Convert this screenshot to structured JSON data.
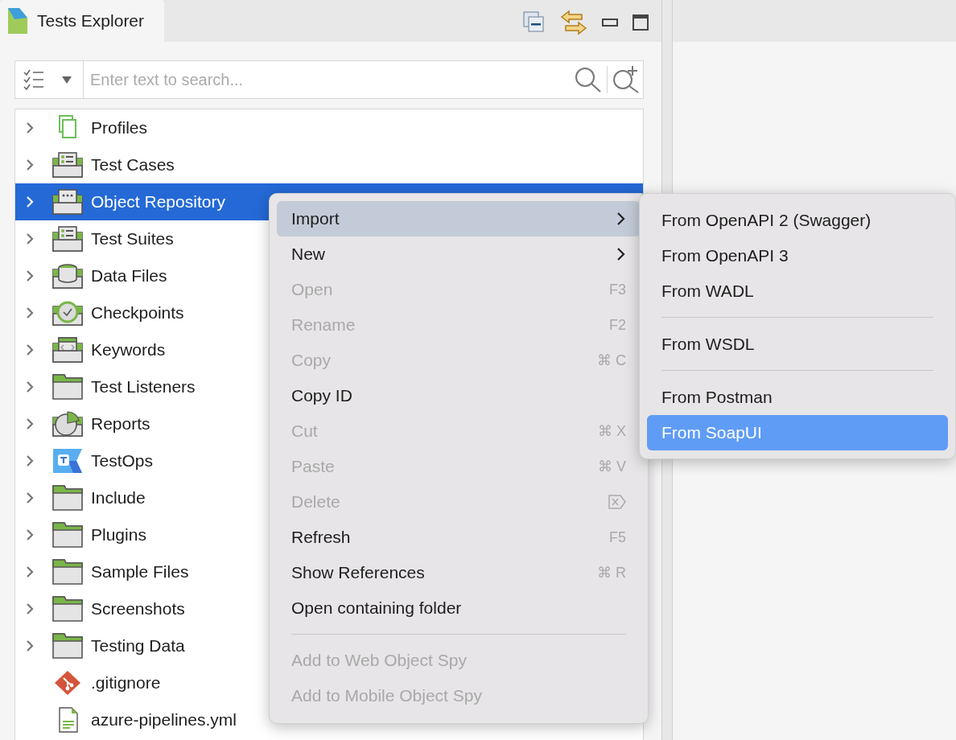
{
  "tab": {
    "title": "Tests Explorer",
    "selected": true
  },
  "search": {
    "placeholder": "Enter text to search..."
  },
  "tree": [
    {
      "label": "Profiles",
      "kind": "profiles",
      "expanded": false,
      "selected": false
    },
    {
      "label": "Test Cases",
      "kind": "cases",
      "expanded": false,
      "selected": false
    },
    {
      "label": "Object Repository",
      "kind": "repository",
      "expanded": false,
      "selected": true
    },
    {
      "label": "Test Suites",
      "kind": "suites",
      "expanded": false,
      "selected": false
    },
    {
      "label": "Data Files",
      "kind": "data",
      "expanded": false,
      "selected": false
    },
    {
      "label": "Checkpoints",
      "kind": "checkpoints",
      "expanded": false,
      "selected": false
    },
    {
      "label": "Keywords",
      "kind": "keywords",
      "expanded": false,
      "selected": false
    },
    {
      "label": "Test Listeners",
      "kind": "folder",
      "expanded": false,
      "selected": false
    },
    {
      "label": "Reports",
      "kind": "reports",
      "expanded": false,
      "selected": false
    },
    {
      "label": "TestOps",
      "kind": "testops",
      "expanded": false,
      "selected": false
    },
    {
      "label": "Include",
      "kind": "folder",
      "expanded": false,
      "selected": false
    },
    {
      "label": "Plugins",
      "kind": "folder",
      "expanded": false,
      "selected": false
    },
    {
      "label": "Sample Files",
      "kind": "folder",
      "expanded": false,
      "selected": false
    },
    {
      "label": "Screenshots",
      "kind": "folder",
      "expanded": false,
      "selected": false
    },
    {
      "label": "Testing Data",
      "kind": "folder",
      "expanded": false,
      "selected": false
    },
    {
      "label": ".gitignore",
      "kind": "git",
      "selected": false
    },
    {
      "label": "azure-pipelines.yml",
      "kind": "file",
      "selected": false
    }
  ],
  "context_menu": [
    {
      "kind": "item",
      "label": "Import",
      "submenu": true,
      "disabled": false,
      "selected": true
    },
    {
      "kind": "item",
      "label": "New",
      "submenu": true,
      "disabled": false,
      "selected": false
    },
    {
      "kind": "item",
      "label": "Open",
      "shortcut": "F3",
      "disabled": true,
      "selected": false
    },
    {
      "kind": "item",
      "label": "Rename",
      "shortcut": "F2",
      "disabled": true,
      "selected": false
    },
    {
      "kind": "item",
      "label": "Copy",
      "shortcut": "⌘ C",
      "disabled": true,
      "selected": false
    },
    {
      "kind": "item",
      "label": "Copy ID",
      "disabled": false,
      "selected": false
    },
    {
      "kind": "item",
      "label": "Cut",
      "shortcut": "⌘ X",
      "disabled": true,
      "selected": false
    },
    {
      "kind": "item",
      "label": "Paste",
      "shortcut": "⌘ V",
      "disabled": true,
      "selected": false
    },
    {
      "kind": "item",
      "label": "Delete",
      "shortcut_icon": true,
      "disabled": true,
      "selected": false
    },
    {
      "kind": "item",
      "label": "Refresh",
      "shortcut": "F5",
      "disabled": false,
      "selected": false
    },
    {
      "kind": "item",
      "label": "Show References",
      "shortcut": "⌘ R",
      "disabled": false,
      "selected": false
    },
    {
      "kind": "item",
      "label": "Open containing folder",
      "disabled": false,
      "selected": false
    },
    {
      "kind": "separator"
    },
    {
      "kind": "item",
      "label": "Add to Web Object Spy",
      "disabled": true,
      "selected": false
    },
    {
      "kind": "item",
      "label": "Add to Mobile Object Spy",
      "disabled": true,
      "selected": false
    }
  ],
  "submenu": [
    {
      "kind": "item",
      "label": "From OpenAPI 2 (Swagger)",
      "selected": false
    },
    {
      "kind": "item",
      "label": "From OpenAPI 3",
      "selected": false
    },
    {
      "kind": "item",
      "label": "From WADL",
      "selected": false
    },
    {
      "kind": "separator"
    },
    {
      "kind": "item",
      "label": "From WSDL",
      "selected": false
    },
    {
      "kind": "separator"
    },
    {
      "kind": "item",
      "label": "From Postman",
      "selected": false
    },
    {
      "kind": "item",
      "label": "From SoapUI",
      "selected": true
    }
  ]
}
